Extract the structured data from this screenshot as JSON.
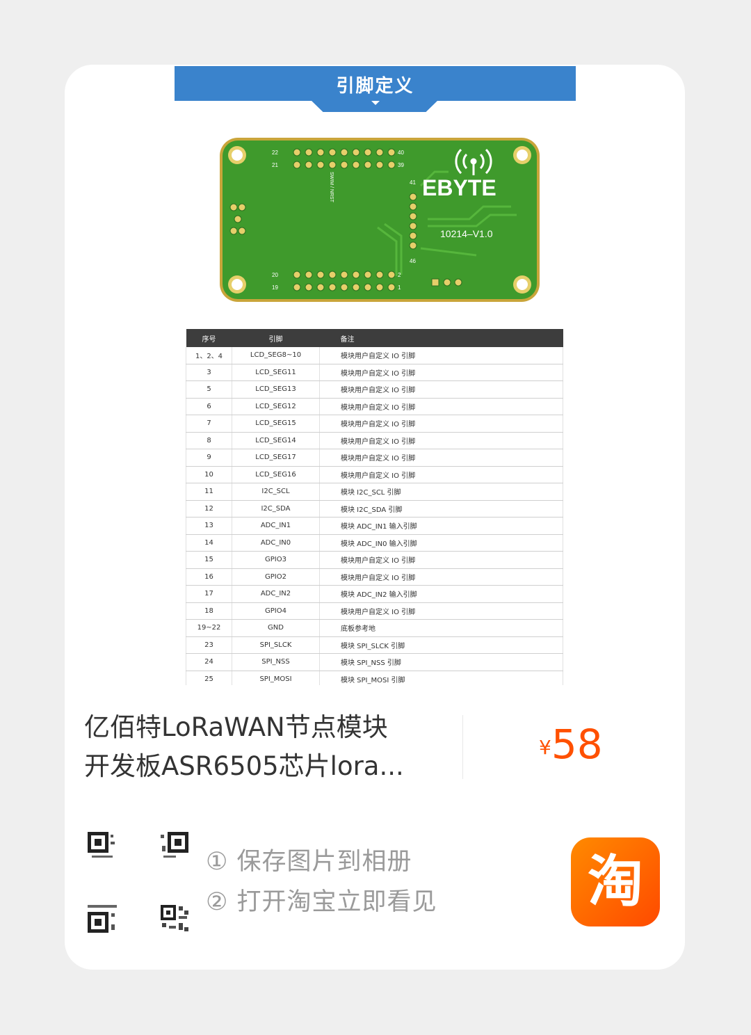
{
  "image": {
    "banner_title": "引脚定义",
    "pcb": {
      "brand": "EBYTE",
      "version": "10214–V1.0",
      "pin_labels": [
        "22",
        "40",
        "21",
        "39",
        "41",
        "46",
        "20",
        "2",
        "19",
        "1"
      ],
      "silk_text": "SWIM / NRST"
    },
    "table": {
      "headers": [
        "序号",
        "引脚",
        "备注"
      ],
      "rows": [
        [
          "1、2、4",
          "LCD_SEG8~10",
          "模块用户自定义 IO 引脚"
        ],
        [
          "3",
          "LCD_SEG11",
          "模块用户自定义 IO 引脚"
        ],
        [
          "5",
          "LCD_SEG13",
          "模块用户自定义 IO 引脚"
        ],
        [
          "6",
          "LCD_SEG12",
          "模块用户自定义 IO 引脚"
        ],
        [
          "7",
          "LCD_SEG15",
          "模块用户自定义 IO 引脚"
        ],
        [
          "8",
          "LCD_SEG14",
          "模块用户自定义 IO 引脚"
        ],
        [
          "9",
          "LCD_SEG17",
          "模块用户自定义 IO 引脚"
        ],
        [
          "10",
          "LCD_SEG16",
          "模块用户自定义 IO 引脚"
        ],
        [
          "11",
          "I2C_SCL",
          "模块 I2C_SCL 引脚"
        ],
        [
          "12",
          "I2C_SDA",
          "模块 I2C_SDA 引脚"
        ],
        [
          "13",
          "ADC_IN1",
          "模块 ADC_IN1 输入引脚"
        ],
        [
          "14",
          "ADC_IN0",
          "模块 ADC_IN0 输入引脚"
        ],
        [
          "15",
          "GPIO3",
          "模块用户自定义 IO 引脚"
        ],
        [
          "16",
          "GPIO2",
          "模块用户自定义 IO 引脚"
        ],
        [
          "17",
          "ADC_IN2",
          "模块 ADC_IN2 输入引脚"
        ],
        [
          "18",
          "GPIO4",
          "模块用户自定义 IO 引脚"
        ],
        [
          "19~22",
          "GND",
          "底板参考地"
        ],
        [
          "23",
          "SPI_SLCK",
          "模块 SPI_SLCK 引脚"
        ],
        [
          "24",
          "SPI_NSS",
          "模块 SPI_NSS 引脚"
        ],
        [
          "25",
          "SPI_MOSI",
          "模块 SPI_MOSI 引脚"
        ]
      ]
    }
  },
  "product": {
    "title_line1": "亿佰特LoRaWAN节点模块",
    "title_line2": "开发板ASR6505芯片lora...",
    "currency": "¥",
    "price": "58"
  },
  "steps": {
    "step1": "① 保存图片到相册",
    "step2": "② 打开淘宝立即看见"
  },
  "app_icon": {
    "glyph": "淘",
    "name": "taobao-icon"
  },
  "colors": {
    "accent": "#ff5000",
    "banner": "#3a83cc",
    "pcb_green": "#3f9a2c",
    "pcb_gold": "#c9a53a"
  }
}
